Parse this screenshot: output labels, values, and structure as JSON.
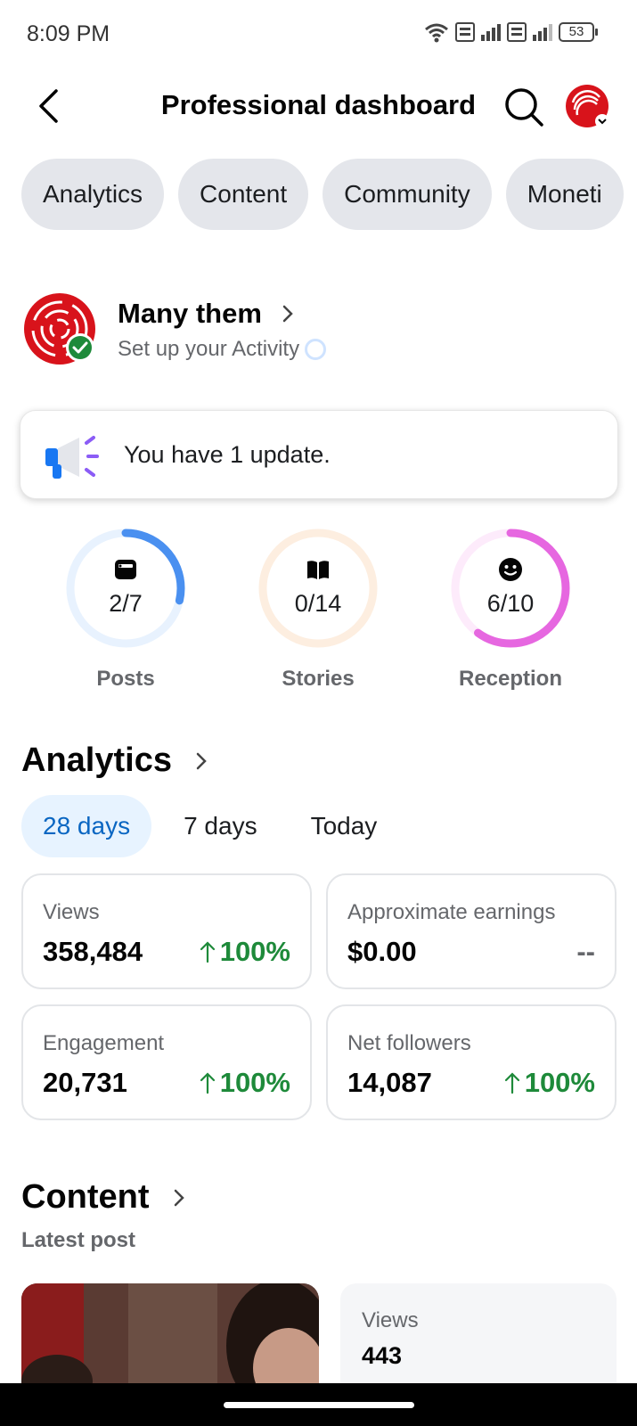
{
  "status_bar": {
    "time": "8:09 PM",
    "battery": "53"
  },
  "header": {
    "title": "Professional dashboard"
  },
  "chips": [
    "Analytics",
    "Content",
    "Community",
    "Moneti"
  ],
  "profile": {
    "name": "Many them",
    "subtitle": "Set up your Activity"
  },
  "update": {
    "text": "You have 1 update."
  },
  "rings": [
    {
      "value": "2/7",
      "label": "Posts",
      "icon": "posts-icon",
      "progress": 0.2857,
      "color": "#4a90f0",
      "track": "#e8f2fe"
    },
    {
      "value": "0/14",
      "label": "Stories",
      "icon": "book-icon",
      "progress": 0,
      "color": "#f7a25c",
      "track": "#fdeee0"
    },
    {
      "value": "6/10",
      "label": "Reception",
      "icon": "smiley-icon",
      "progress": 0.6,
      "color": "#e667e0",
      "track": "#fdebfb"
    }
  ],
  "analytics": {
    "title": "Analytics",
    "ranges": [
      "28 days",
      "7 days",
      "Today"
    ],
    "selected_range": "28 days",
    "metrics": [
      {
        "label": "Views",
        "value": "358,484",
        "change": "100%",
        "trend": "up"
      },
      {
        "label": "Approximate earnings",
        "value": "$0.00",
        "change": "--",
        "trend": "none"
      },
      {
        "label": "Engagement",
        "value": "20,731",
        "change": "100%",
        "trend": "up"
      },
      {
        "label": "Net followers",
        "value": "14,087",
        "change": "100%",
        "trend": "up"
      }
    ]
  },
  "content": {
    "title": "Content",
    "latest_label": "Latest post",
    "post_stat": {
      "label": "Views",
      "value": "443"
    }
  },
  "colors": {
    "accent": "#0a66c2",
    "positive": "#1e8a3a",
    "chip_bg": "#e4e6eb"
  }
}
